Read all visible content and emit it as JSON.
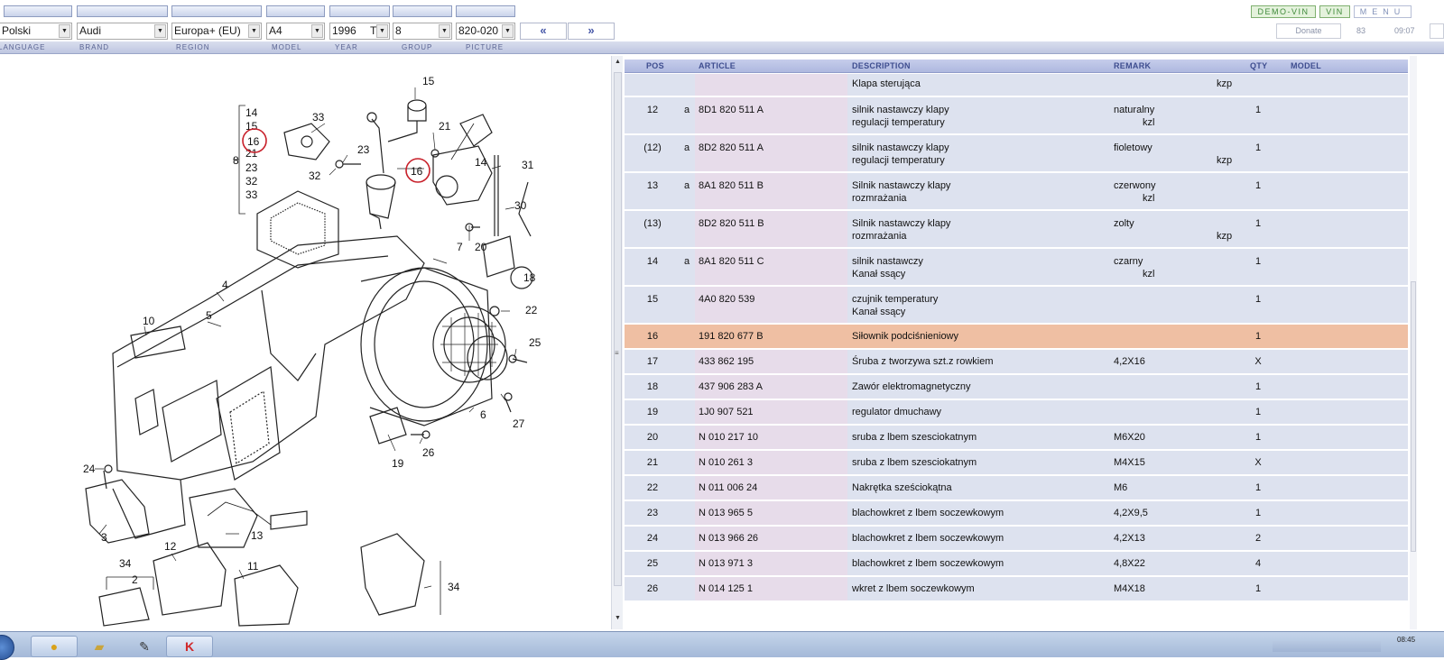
{
  "header": {
    "right_buttons": [
      "DEMO-VIN",
      "VIN",
      "MENU"
    ]
  },
  "selectors": {
    "language": "Polski",
    "brand": "Audi",
    "region": "Europa+ (EU)",
    "model": "A4",
    "year": "1996",
    "year_type": "T",
    "group": "8",
    "picture": "820-020",
    "prev": "«",
    "next": "»",
    "donate": "Donate",
    "counter": "83",
    "time": "09:07"
  },
  "labels": [
    "LANGUAGE",
    "BRAND",
    "REGION",
    "MODEL",
    "YEAR",
    "GROUP",
    "PICTURE"
  ],
  "diagram": {
    "callouts": [
      "14",
      "15",
      "16",
      "21",
      "23",
      "32",
      "33",
      "8",
      "15",
      "33",
      "21",
      "23",
      "32",
      "16",
      "14",
      "31",
      "30",
      "20",
      "7",
      "18",
      "4",
      "5",
      "10",
      "22",
      "25",
      "6",
      "27",
      "19",
      "26",
      "24",
      "3",
      "13",
      "12",
      "11",
      "34",
      "2",
      "34"
    ]
  },
  "table": {
    "columns": {
      "pos": "POS",
      "article": "ARTICLE",
      "description": "DESCRIPTION",
      "remark": "REMARK",
      "qty": "QTY",
      "model": "MODEL"
    },
    "top_partial": {
      "description": "Klapa sterująca",
      "remark2": "kzp"
    },
    "rows": [
      {
        "pos": "12",
        "a": "a",
        "article": "8D1 820 511 A",
        "desc1": "silnik nastawczy klapy",
        "desc2": "regulacji temperatury",
        "remark1": "naturalny",
        "remark2": "kzl",
        "remark2_right": "",
        "qty": "1"
      },
      {
        "pos": "(12)",
        "a": "a",
        "article": "8D2 820 511 A",
        "desc1": "silnik nastawczy klapy",
        "desc2": "regulacji temperatury",
        "remark1": "fioletowy",
        "remark2": "",
        "remark2_right": "kzp",
        "qty": "1"
      },
      {
        "pos": "13",
        "a": "a",
        "article": "8A1 820 511 B",
        "desc1": "Silnik nastawczy klapy",
        "desc2": "rozmrażania",
        "remark1": "czerwony",
        "remark2": "kzl",
        "remark2_right": "",
        "qty": "1"
      },
      {
        "pos": "(13)",
        "a": "",
        "article": "8D2 820 511 B",
        "desc1": "Silnik nastawczy klapy",
        "desc2": "rozmrażania",
        "remark1": "zolty",
        "remark2": "",
        "remark2_right": "kzp",
        "qty": "1"
      },
      {
        "pos": "14",
        "a": "a",
        "article": "8A1 820 511 C",
        "desc1": "silnik nastawczy",
        "desc2": "Kanał ssący",
        "remark1": "czarny",
        "remark2": "kzl",
        "remark2_right": "",
        "qty": "1"
      },
      {
        "pos": "15",
        "a": "",
        "article": "4A0 820 539",
        "desc1": "czujnik temperatury",
        "desc2": "Kanał ssący",
        "remark1": "",
        "remark2": "",
        "remark2_right": "",
        "qty": "1"
      },
      {
        "pos": "16",
        "a": "",
        "article": "191 820 677 B",
        "desc1": "Siłownik podciśnieniowy",
        "desc2": "",
        "remark1": "",
        "remark2": "",
        "remark2_right": "",
        "qty": "1",
        "highlight": true
      },
      {
        "pos": "17",
        "a": "",
        "article": "433 862 195",
        "desc1": "Śruba z tworzywa szt.z rowkiem",
        "desc2": "",
        "remark1": "4,2X16",
        "remark2": "",
        "remark2_right": "",
        "qty": "X"
      },
      {
        "pos": "18",
        "a": "",
        "article": "437 906 283 A",
        "desc1": "Zawór elektromagnetyczny",
        "desc2": "",
        "remark1": "",
        "remark2": "",
        "remark2_right": "",
        "qty": "1"
      },
      {
        "pos": "19",
        "a": "",
        "article": "1J0 907 521",
        "desc1": "regulator dmuchawy",
        "desc2": "",
        "remark1": "",
        "remark2": "",
        "remark2_right": "",
        "qty": "1"
      },
      {
        "pos": "20",
        "a": "",
        "article": "N  010 217 10",
        "desc1": "sruba  z lbem szesciokatnym",
        "desc2": "",
        "remark1": "M6X20",
        "remark2": "",
        "remark2_right": "",
        "qty": "1"
      },
      {
        "pos": "21",
        "a": "",
        "article": "N  010 261 3",
        "desc1": "sruba  z lbem szesciokatnym",
        "desc2": "",
        "remark1": "M4X15",
        "remark2": "",
        "remark2_right": "",
        "qty": "X"
      },
      {
        "pos": "22",
        "a": "",
        "article": "N  011 006 24",
        "desc1": "Nakrętka sześciokątna",
        "desc2": "",
        "remark1": "M6",
        "remark2": "",
        "remark2_right": "",
        "qty": "1"
      },
      {
        "pos": "23",
        "a": "",
        "article": "N  013 965 5",
        "desc1": "blachowkret z lbem soczewkowym",
        "desc2": "",
        "remark1": "4,2X9,5",
        "remark2": "",
        "remark2_right": "",
        "qty": "1"
      },
      {
        "pos": "24",
        "a": "",
        "article": "N  013 966 26",
        "desc1": "blachowkret z lbem soczewkowym",
        "desc2": "",
        "remark1": "4,2X13",
        "remark2": "",
        "remark2_right": "",
        "qty": "2"
      },
      {
        "pos": "25",
        "a": "",
        "article": "N  013 971 3",
        "desc1": "blachowkret z lbem soczewkowym",
        "desc2": "",
        "remark1": "4,8X22",
        "remark2": "",
        "remark2_right": "",
        "qty": "4"
      },
      {
        "pos": "26",
        "a": "",
        "article": "N  014 125 1",
        "desc1": "wkret z lbem soczewkowym",
        "desc2": "",
        "remark1": "M4X18",
        "remark2": "",
        "remark2_right": "",
        "qty": "1"
      }
    ]
  },
  "taskbar": {
    "clock": "08:45"
  },
  "colors": {
    "row_bg": "#dde2ef",
    "article_bg": "#e7dcea",
    "highlight": "#efbfa3",
    "header_bg": "#c6cdeb",
    "callout_circle": "#c8202a"
  }
}
